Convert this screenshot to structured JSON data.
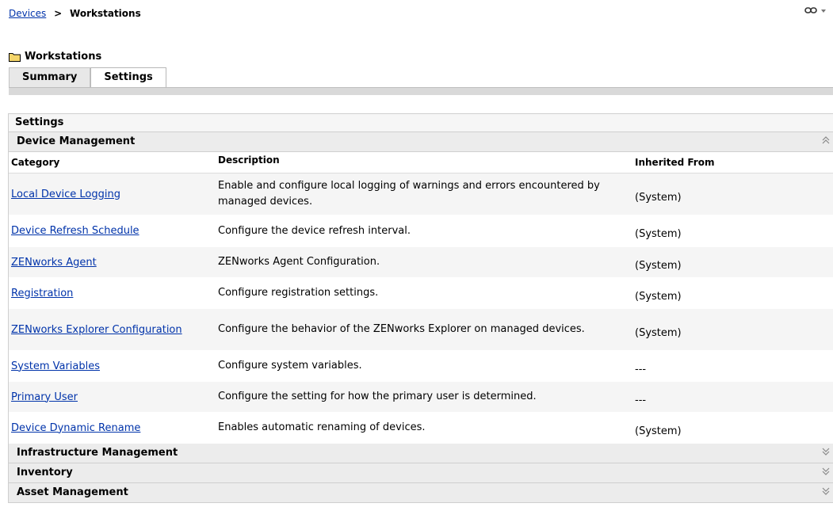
{
  "breadcrumb": {
    "link": "Devices",
    "separator": ">",
    "current": "Workstations"
  },
  "top_icons": [
    "link-icon",
    "dropdown-arrow-icon"
  ],
  "page": {
    "title": "Workstations",
    "icon": "folder-icon"
  },
  "tabs": [
    {
      "label": "Summary",
      "active": false
    },
    {
      "label": "Settings",
      "active": true
    }
  ],
  "panel": {
    "title": "Settings",
    "sections": [
      {
        "label": "Device Management",
        "expanded": true
      },
      {
        "label": "Infrastructure Management",
        "expanded": false
      },
      {
        "label": "Inventory",
        "expanded": false
      },
      {
        "label": "Asset Management",
        "expanded": false
      }
    ],
    "columns": [
      "Category",
      "Description",
      "Inherited From"
    ],
    "rows": [
      {
        "category": "Local Device Logging",
        "description": "Enable and configure local logging of warnings and errors encountered by managed devices.",
        "inherited": "(System)"
      },
      {
        "category": "Device Refresh Schedule",
        "description": "Configure the device refresh interval.",
        "inherited": "(System)"
      },
      {
        "category": "ZENworks Agent",
        "description": "ZENworks Agent Configuration.",
        "inherited": "(System)"
      },
      {
        "category": "Registration",
        "description": "Configure registration settings.",
        "inherited": "(System)"
      },
      {
        "category": "ZENworks Explorer Configuration",
        "description": "Configure the behavior of the ZENworks Explorer on managed devices.",
        "inherited": "(System)"
      },
      {
        "category": "System Variables",
        "description": "Configure system variables.",
        "inherited": "---"
      },
      {
        "category": "Primary User",
        "description": "Configure the setting for how the primary user is determined.",
        "inherited": "---"
      },
      {
        "category": "Device Dynamic Rename",
        "description": "Enables automatic renaming of devices.",
        "inherited": "(System)"
      }
    ]
  },
  "colors": {
    "link": "#0033aa",
    "header_bg": "#ececec",
    "row_alt_bg": "#f5f5f5",
    "tab_bar": "#d9d9d9"
  }
}
